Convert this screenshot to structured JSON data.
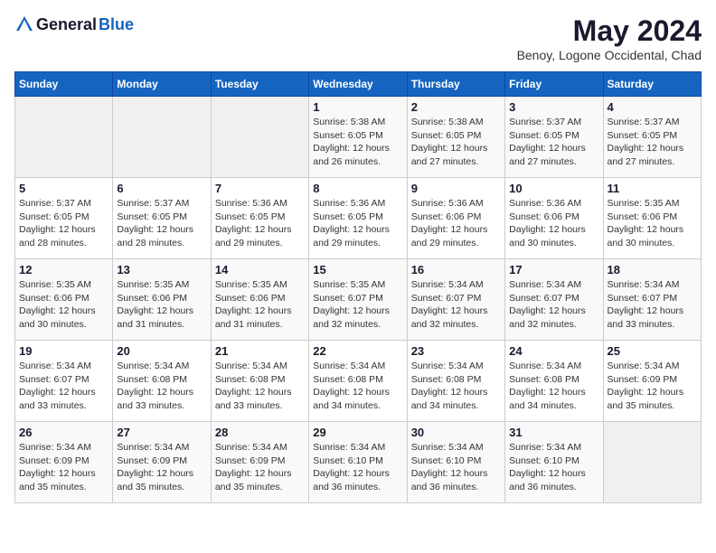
{
  "header": {
    "logo_general": "General",
    "logo_blue": "Blue",
    "title": "May 2024",
    "location": "Benoy, Logone Occidental, Chad"
  },
  "weekdays": [
    "Sunday",
    "Monday",
    "Tuesday",
    "Wednesday",
    "Thursday",
    "Friday",
    "Saturday"
  ],
  "weeks": [
    [
      {
        "day": "",
        "sunrise": "",
        "sunset": "",
        "daylight": ""
      },
      {
        "day": "",
        "sunrise": "",
        "sunset": "",
        "daylight": ""
      },
      {
        "day": "",
        "sunrise": "",
        "sunset": "",
        "daylight": ""
      },
      {
        "day": "1",
        "sunrise": "Sunrise: 5:38 AM",
        "sunset": "Sunset: 6:05 PM",
        "daylight": "Daylight: 12 hours and 26 minutes."
      },
      {
        "day": "2",
        "sunrise": "Sunrise: 5:38 AM",
        "sunset": "Sunset: 6:05 PM",
        "daylight": "Daylight: 12 hours and 27 minutes."
      },
      {
        "day": "3",
        "sunrise": "Sunrise: 5:37 AM",
        "sunset": "Sunset: 6:05 PM",
        "daylight": "Daylight: 12 hours and 27 minutes."
      },
      {
        "day": "4",
        "sunrise": "Sunrise: 5:37 AM",
        "sunset": "Sunset: 6:05 PM",
        "daylight": "Daylight: 12 hours and 27 minutes."
      }
    ],
    [
      {
        "day": "5",
        "sunrise": "Sunrise: 5:37 AM",
        "sunset": "Sunset: 6:05 PM",
        "daylight": "Daylight: 12 hours and 28 minutes."
      },
      {
        "day": "6",
        "sunrise": "Sunrise: 5:37 AM",
        "sunset": "Sunset: 6:05 PM",
        "daylight": "Daylight: 12 hours and 28 minutes."
      },
      {
        "day": "7",
        "sunrise": "Sunrise: 5:36 AM",
        "sunset": "Sunset: 6:05 PM",
        "daylight": "Daylight: 12 hours and 29 minutes."
      },
      {
        "day": "8",
        "sunrise": "Sunrise: 5:36 AM",
        "sunset": "Sunset: 6:05 PM",
        "daylight": "Daylight: 12 hours and 29 minutes."
      },
      {
        "day": "9",
        "sunrise": "Sunrise: 5:36 AM",
        "sunset": "Sunset: 6:06 PM",
        "daylight": "Daylight: 12 hours and 29 minutes."
      },
      {
        "day": "10",
        "sunrise": "Sunrise: 5:36 AM",
        "sunset": "Sunset: 6:06 PM",
        "daylight": "Daylight: 12 hours and 30 minutes."
      },
      {
        "day": "11",
        "sunrise": "Sunrise: 5:35 AM",
        "sunset": "Sunset: 6:06 PM",
        "daylight": "Daylight: 12 hours and 30 minutes."
      }
    ],
    [
      {
        "day": "12",
        "sunrise": "Sunrise: 5:35 AM",
        "sunset": "Sunset: 6:06 PM",
        "daylight": "Daylight: 12 hours and 30 minutes."
      },
      {
        "day": "13",
        "sunrise": "Sunrise: 5:35 AM",
        "sunset": "Sunset: 6:06 PM",
        "daylight": "Daylight: 12 hours and 31 minutes."
      },
      {
        "day": "14",
        "sunrise": "Sunrise: 5:35 AM",
        "sunset": "Sunset: 6:06 PM",
        "daylight": "Daylight: 12 hours and 31 minutes."
      },
      {
        "day": "15",
        "sunrise": "Sunrise: 5:35 AM",
        "sunset": "Sunset: 6:07 PM",
        "daylight": "Daylight: 12 hours and 32 minutes."
      },
      {
        "day": "16",
        "sunrise": "Sunrise: 5:34 AM",
        "sunset": "Sunset: 6:07 PM",
        "daylight": "Daylight: 12 hours and 32 minutes."
      },
      {
        "day": "17",
        "sunrise": "Sunrise: 5:34 AM",
        "sunset": "Sunset: 6:07 PM",
        "daylight": "Daylight: 12 hours and 32 minutes."
      },
      {
        "day": "18",
        "sunrise": "Sunrise: 5:34 AM",
        "sunset": "Sunset: 6:07 PM",
        "daylight": "Daylight: 12 hours and 33 minutes."
      }
    ],
    [
      {
        "day": "19",
        "sunrise": "Sunrise: 5:34 AM",
        "sunset": "Sunset: 6:07 PM",
        "daylight": "Daylight: 12 hours and 33 minutes."
      },
      {
        "day": "20",
        "sunrise": "Sunrise: 5:34 AM",
        "sunset": "Sunset: 6:08 PM",
        "daylight": "Daylight: 12 hours and 33 minutes."
      },
      {
        "day": "21",
        "sunrise": "Sunrise: 5:34 AM",
        "sunset": "Sunset: 6:08 PM",
        "daylight": "Daylight: 12 hours and 33 minutes."
      },
      {
        "day": "22",
        "sunrise": "Sunrise: 5:34 AM",
        "sunset": "Sunset: 6:08 PM",
        "daylight": "Daylight: 12 hours and 34 minutes."
      },
      {
        "day": "23",
        "sunrise": "Sunrise: 5:34 AM",
        "sunset": "Sunset: 6:08 PM",
        "daylight": "Daylight: 12 hours and 34 minutes."
      },
      {
        "day": "24",
        "sunrise": "Sunrise: 5:34 AM",
        "sunset": "Sunset: 6:08 PM",
        "daylight": "Daylight: 12 hours and 34 minutes."
      },
      {
        "day": "25",
        "sunrise": "Sunrise: 5:34 AM",
        "sunset": "Sunset: 6:09 PM",
        "daylight": "Daylight: 12 hours and 35 minutes."
      }
    ],
    [
      {
        "day": "26",
        "sunrise": "Sunrise: 5:34 AM",
        "sunset": "Sunset: 6:09 PM",
        "daylight": "Daylight: 12 hours and 35 minutes."
      },
      {
        "day": "27",
        "sunrise": "Sunrise: 5:34 AM",
        "sunset": "Sunset: 6:09 PM",
        "daylight": "Daylight: 12 hours and 35 minutes."
      },
      {
        "day": "28",
        "sunrise": "Sunrise: 5:34 AM",
        "sunset": "Sunset: 6:09 PM",
        "daylight": "Daylight: 12 hours and 35 minutes."
      },
      {
        "day": "29",
        "sunrise": "Sunrise: 5:34 AM",
        "sunset": "Sunset: 6:10 PM",
        "daylight": "Daylight: 12 hours and 36 minutes."
      },
      {
        "day": "30",
        "sunrise": "Sunrise: 5:34 AM",
        "sunset": "Sunset: 6:10 PM",
        "daylight": "Daylight: 12 hours and 36 minutes."
      },
      {
        "day": "31",
        "sunrise": "Sunrise: 5:34 AM",
        "sunset": "Sunset: 6:10 PM",
        "daylight": "Daylight: 12 hours and 36 minutes."
      },
      {
        "day": "",
        "sunrise": "",
        "sunset": "",
        "daylight": ""
      }
    ]
  ]
}
